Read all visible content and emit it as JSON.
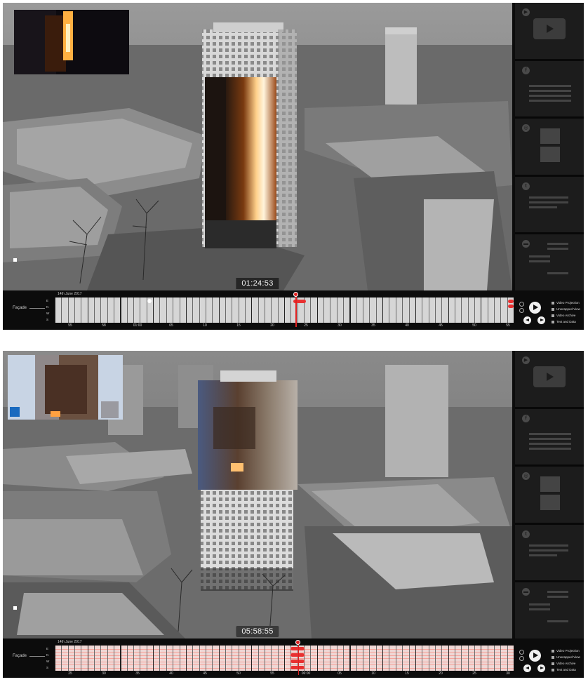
{
  "panels": [
    {
      "timecode": "01:24:53",
      "timeline": {
        "date": "14th June 2017",
        "facade_label": "Façade",
        "rows": [
          "E",
          "N",
          "W",
          "S"
        ],
        "ticks": [
          "55",
          "58",
          "01:00",
          "05",
          "10",
          "15",
          "20",
          "25",
          "30",
          "35",
          "40",
          "45",
          "50",
          "55"
        ],
        "playhead_fraction": 0.525,
        "track_style": "grey"
      },
      "layers": [
        "Video Projection",
        "Unwrapped View",
        "Video Archive",
        "Text and Data"
      ]
    },
    {
      "timecode": "05:58:55",
      "timeline": {
        "date": "14th June 2017",
        "facade_label": "Façade",
        "rows": [
          "E",
          "N",
          "W",
          "S"
        ],
        "ticks": [
          "25",
          "30",
          "35",
          "40",
          "45",
          "50",
          "55",
          "06:00",
          "05",
          "10",
          "15",
          "20",
          "25",
          "30"
        ],
        "playhead_fraction": 0.53,
        "track_style": "pink"
      },
      "layers": [
        "Video Projection",
        "Unwrapped View",
        "Video Archive",
        "Text and Data"
      ]
    }
  ],
  "sidebar_cards": [
    {
      "icon": "youtube-icon"
    },
    {
      "icon": "facebook-icon"
    },
    {
      "icon": "instagram-icon"
    },
    {
      "icon": "twitter-icon"
    },
    {
      "icon": "chat-icon"
    }
  ],
  "colors": {
    "playhead": "#e02020",
    "event": "#e83030",
    "track_grey": "#d6d6d6",
    "track_pink": "#efd7d5"
  }
}
